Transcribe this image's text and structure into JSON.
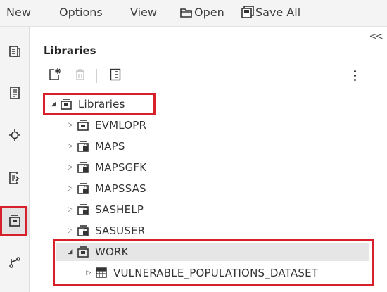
{
  "menu": {
    "new": "New",
    "options": "Options",
    "view": "View",
    "open": "Open",
    "save_all": "Save All",
    "open_icon": "folder-open-icon",
    "save_all_icon": "save-all-icon"
  },
  "rail": {
    "items": [
      {
        "name": "server-files-icon"
      },
      {
        "name": "sas-content-icon"
      },
      {
        "name": "snippets-icon"
      },
      {
        "name": "tasks-icon"
      },
      {
        "name": "libraries-icon",
        "active": true
      },
      {
        "name": "git-icon"
      }
    ]
  },
  "panel": {
    "title": "Libraries",
    "collapse_glyph": "<<",
    "toolbar": [
      "new-library-icon",
      "delete-icon",
      "properties-icon",
      "more-options-icon"
    ]
  },
  "tree": {
    "root": "Libraries",
    "libraries": [
      "EVMLOPR",
      "MAPS",
      "MAPSGFK",
      "MAPSSAS",
      "SASHELP",
      "SASUSER",
      "WORK"
    ],
    "work_child": "VULNERABLE_POPULATIONS_DATASET"
  },
  "colors": {
    "highlight": "#d8202b",
    "menubar_bg": "#f4f4f4",
    "selected_row": "#e6e6e6"
  }
}
